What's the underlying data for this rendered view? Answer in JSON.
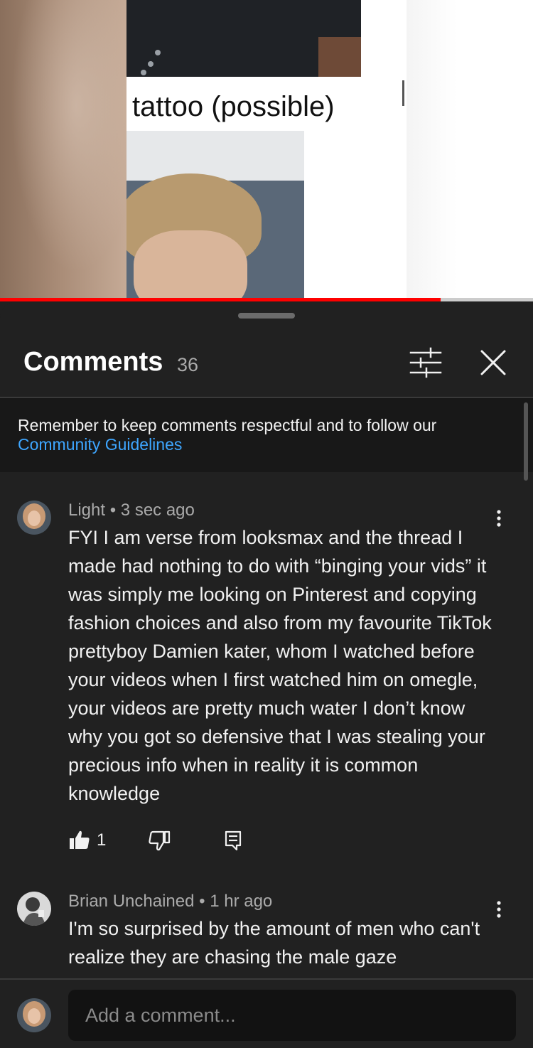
{
  "video": {
    "caption": "tattoo (possible)",
    "progress_fraction": 0.827
  },
  "comments_panel": {
    "title": "Comments",
    "count": "36",
    "notice": {
      "text": "Remember to keep comments respectful and to follow our",
      "link": "Community Guidelines"
    },
    "comments": [
      {
        "author": "Light",
        "separator": "•",
        "time": "3 sec ago",
        "text": "FYI I am verse from looksmax and the thread I made had nothing to do with “binging your vids” it was simply me looking on Pinterest and copying fashion choices and also from my favourite TikTok prettyboy Damien kater, whom I watched before your videos when I first watched him on omegle, your videos are pretty much water I don’t know why you got so defensive that I was stealing your precious info when in reality it is common knowledge",
        "likes": "1"
      },
      {
        "author": "Brian Unchained",
        "separator": "•",
        "time": "1 hr ago",
        "text": "I'm so surprised by the amount of men who can't realize they are chasing the male gaze"
      }
    ],
    "input": {
      "placeholder": "Add a comment..."
    }
  },
  "colors": {
    "background": "#212121",
    "notice_bg": "#181818",
    "link": "#3ea6ff",
    "progress": "#ff0000"
  },
  "icons": [
    "filter-icon",
    "close-icon",
    "more-vert-icon",
    "thumb-up-icon",
    "thumb-down-icon",
    "reply-icon"
  ]
}
